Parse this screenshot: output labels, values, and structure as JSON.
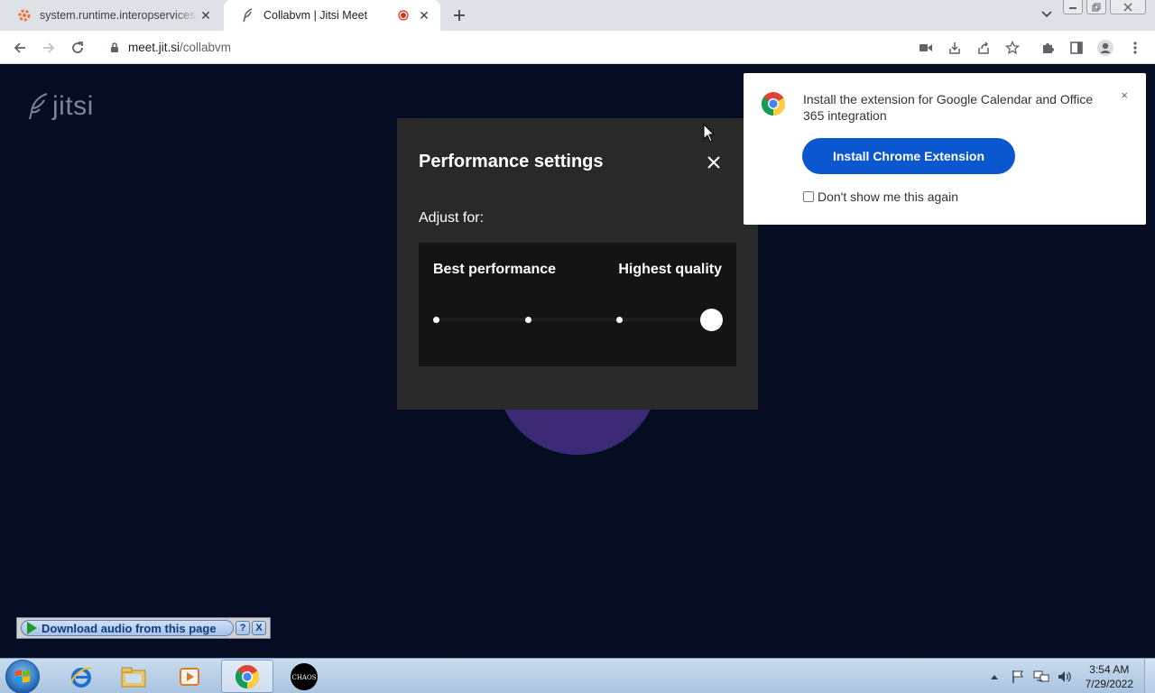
{
  "browser": {
    "tabs": [
      {
        "title": "system.runtime.interopservices.dll",
        "active": false
      },
      {
        "title": "Collabvm | Jitsi Meet",
        "active": true
      }
    ],
    "url_host": "meet.jit.si",
    "url_path": "/collabvm"
  },
  "page": {
    "logo_text": "jitsi",
    "modal": {
      "title": "Performance settings",
      "adjust_label": "Adjust for:",
      "left_label": "Best performance",
      "right_label": "Highest quality",
      "slider_steps": 4,
      "slider_value_index": 3
    },
    "extension_banner": {
      "message": "Install the extension for Google Calendar and Office 365 integration",
      "install_button": "Install Chrome Extension",
      "dont_show_label": "Don't show me this again",
      "close_symbol": "×"
    },
    "download_bar": {
      "label": "Download audio from this page",
      "help": "?",
      "close": "X"
    }
  },
  "taskbar": {
    "apps": [
      "internet-explorer",
      "file-explorer",
      "media-player",
      "chrome",
      "chaos"
    ],
    "chaos_label": "CHAOS",
    "clock_time": "3:54 AM",
    "clock_date": "7/29/2022"
  },
  "colors": {
    "page_bg": "#040d22",
    "modal_bg": "#292929",
    "panel_bg": "#141414",
    "accent_button": "#0b57d0",
    "avatar": "#3d2a77"
  }
}
